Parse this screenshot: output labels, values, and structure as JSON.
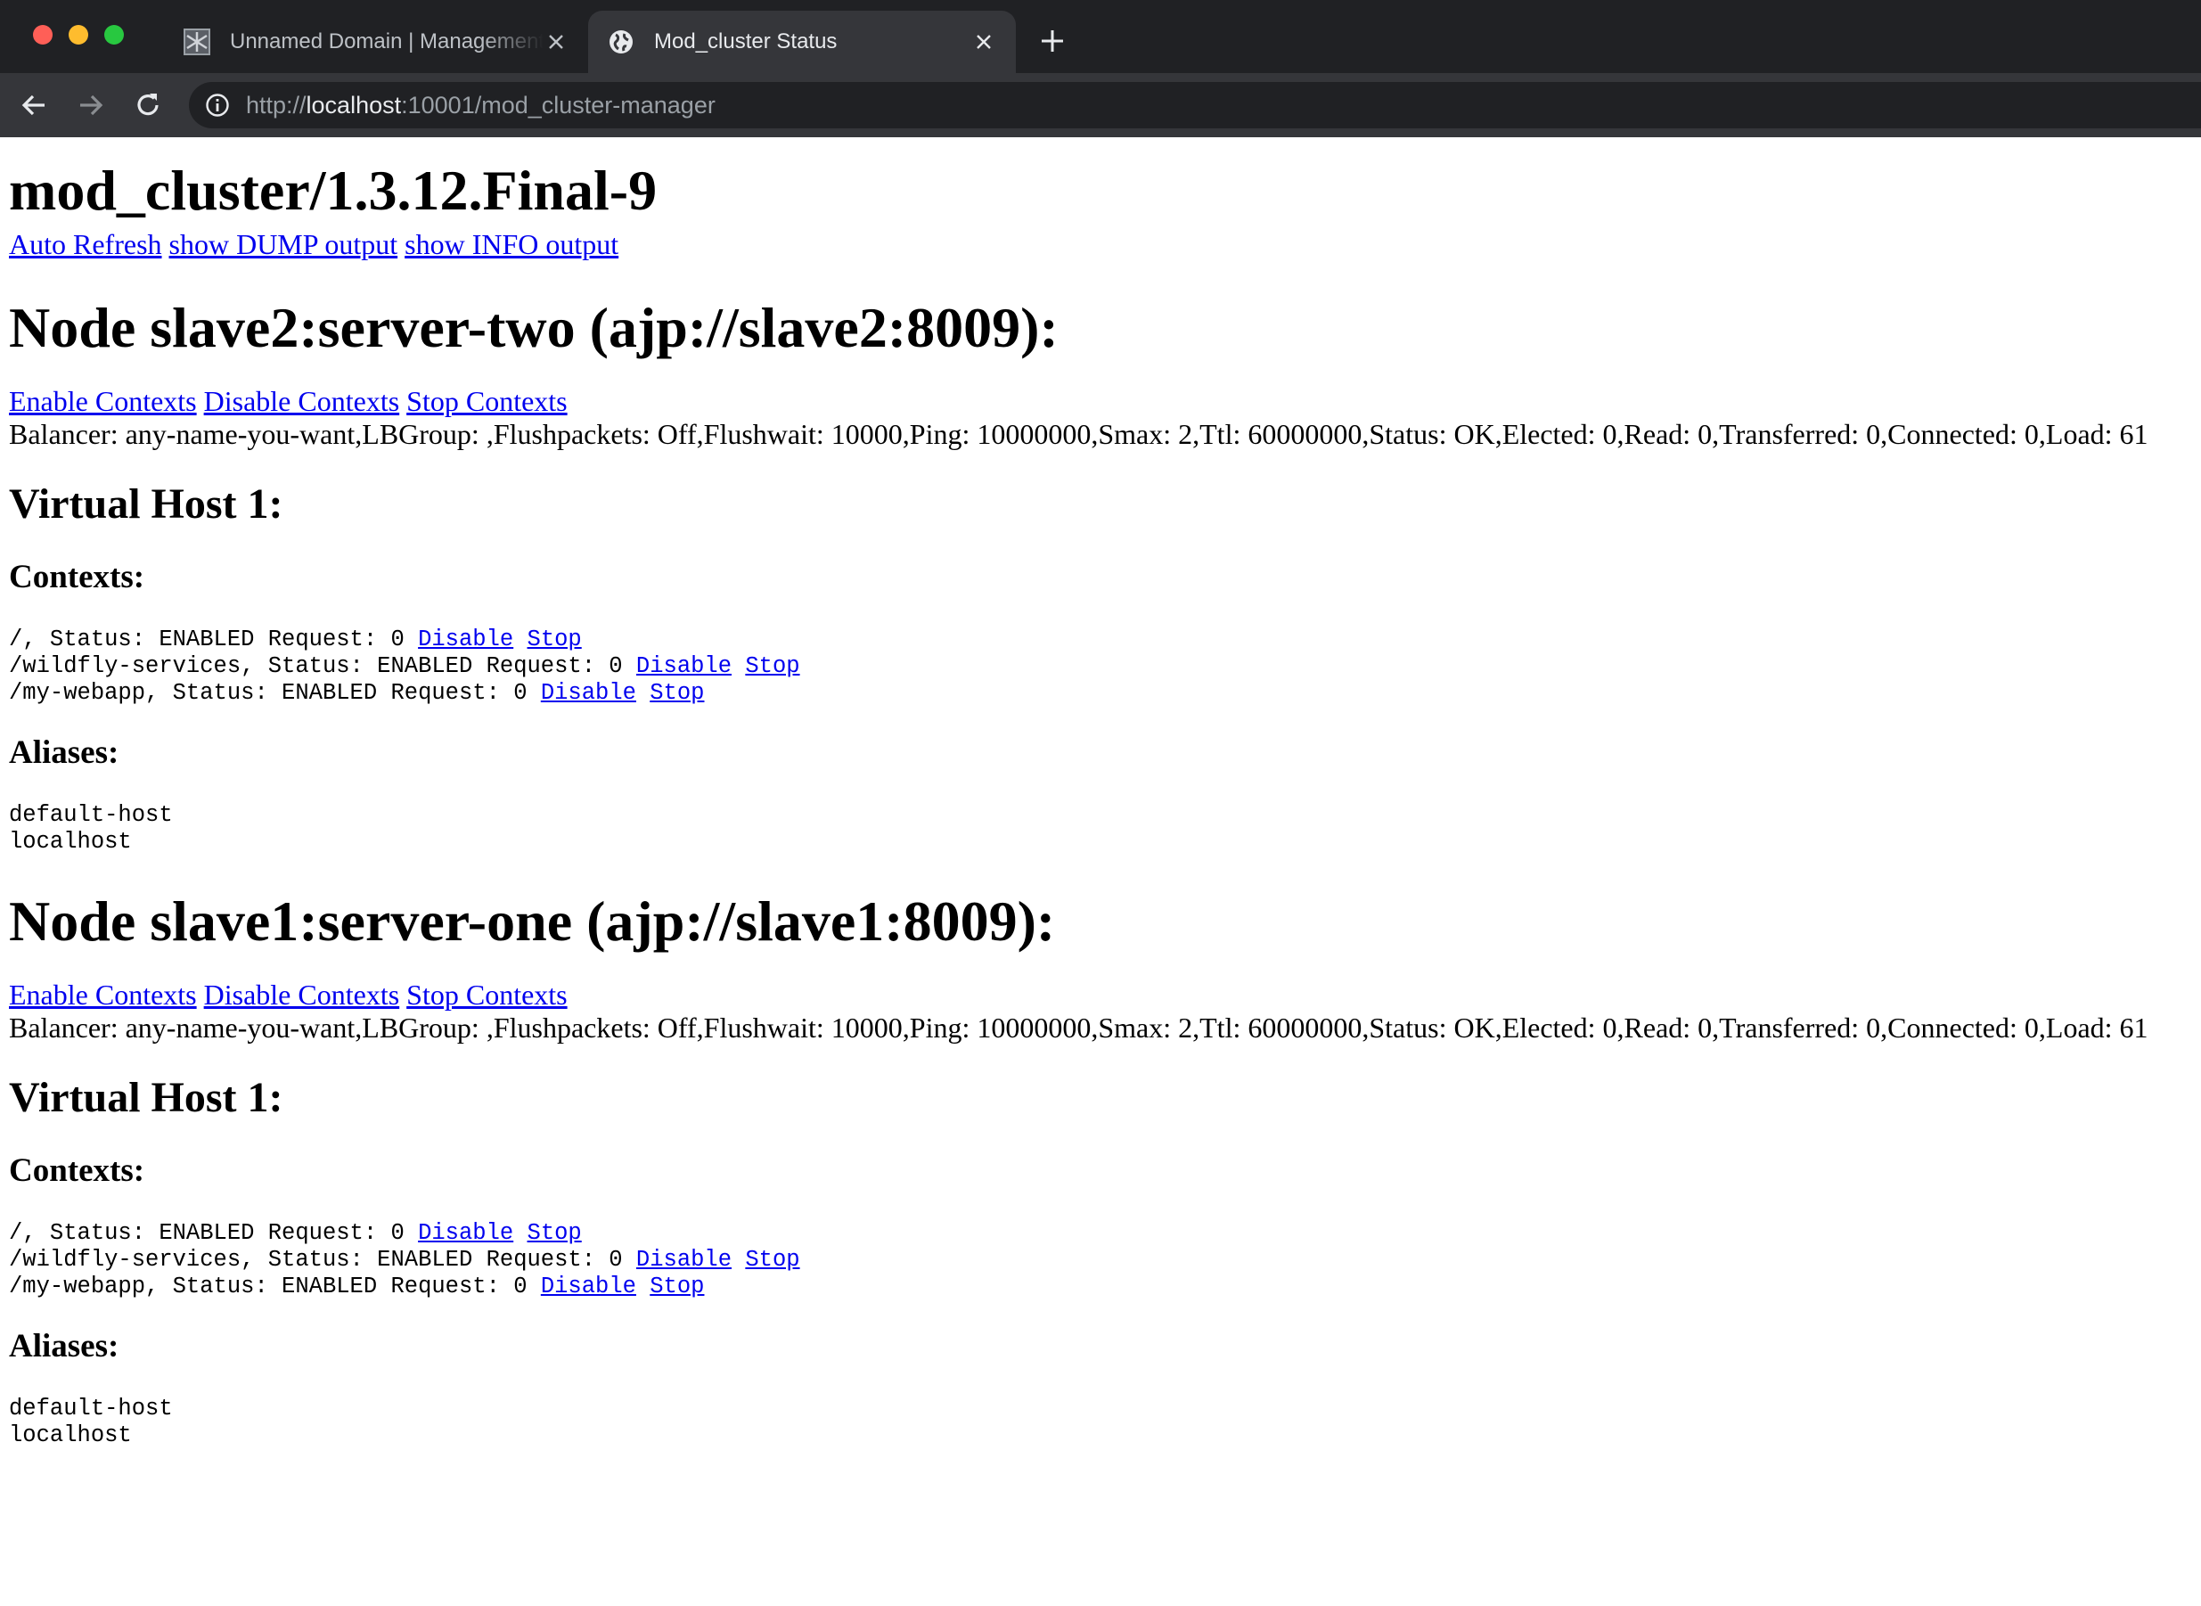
{
  "browser": {
    "tabs": [
      {
        "title": "Unnamed Domain | Management Console",
        "favicon": "wildfly-icon",
        "active": false
      },
      {
        "title": "Mod_cluster Status",
        "favicon": "globe-icon",
        "active": true
      }
    ],
    "url_scheme": "http://",
    "url_host": "localhost",
    "url_rest": ":10001/mod_cluster-manager"
  },
  "page": {
    "title": "mod_cluster/1.3.12.Final-9",
    "top_links": {
      "auto_refresh": "Auto Refresh",
      "show_dump": "show DUMP output",
      "show_info": "show INFO output"
    },
    "nodes": [
      {
        "heading": "Node slave2:server-two (ajp://slave2:8009):",
        "enable_contexts": "Enable Contexts",
        "disable_contexts": "Disable Contexts",
        "stop_contexts": "Stop Contexts",
        "balancer_line": "Balancer: any-name-you-want,LBGroup: ,Flushpackets: Off,Flushwait: 10000,Ping: 10000000,Smax: 2,Ttl: 60000000,Status: OK,Elected: 0,Read: 0,Transferred: 0,Connected: 0,Load: 61",
        "virtual_host": "Virtual Host 1:",
        "contexts_heading": "Contexts:",
        "contexts": [
          {
            "text": "/, Status: ENABLED Request: 0 ",
            "disable": "Disable",
            "stop": "Stop"
          },
          {
            "text": "/wildfly-services, Status: ENABLED Request: 0 ",
            "disable": "Disable",
            "stop": "Stop"
          },
          {
            "text": "/my-webapp, Status: ENABLED Request: 0 ",
            "disable": "Disable",
            "stop": "Stop"
          }
        ],
        "aliases_heading": "Aliases:",
        "aliases": [
          "default-host",
          "localhost"
        ]
      },
      {
        "heading": "Node slave1:server-one (ajp://slave1:8009):",
        "enable_contexts": "Enable Contexts",
        "disable_contexts": "Disable Contexts",
        "stop_contexts": "Stop Contexts",
        "balancer_line": "Balancer: any-name-you-want,LBGroup: ,Flushpackets: Off,Flushwait: 10000,Ping: 10000000,Smax: 2,Ttl: 60000000,Status: OK,Elected: 0,Read: 0,Transferred: 0,Connected: 0,Load: 61",
        "virtual_host": "Virtual Host 1:",
        "contexts_heading": "Contexts:",
        "contexts": [
          {
            "text": "/, Status: ENABLED Request: 0 ",
            "disable": "Disable",
            "stop": "Stop"
          },
          {
            "text": "/wildfly-services, Status: ENABLED Request: 0 ",
            "disable": "Disable",
            "stop": "Stop"
          },
          {
            "text": "/my-webapp, Status: ENABLED Request: 0 ",
            "disable": "Disable",
            "stop": "Stop"
          }
        ],
        "aliases_heading": "Aliases:",
        "aliases": [
          "default-host",
          "localhost"
        ]
      }
    ]
  }
}
